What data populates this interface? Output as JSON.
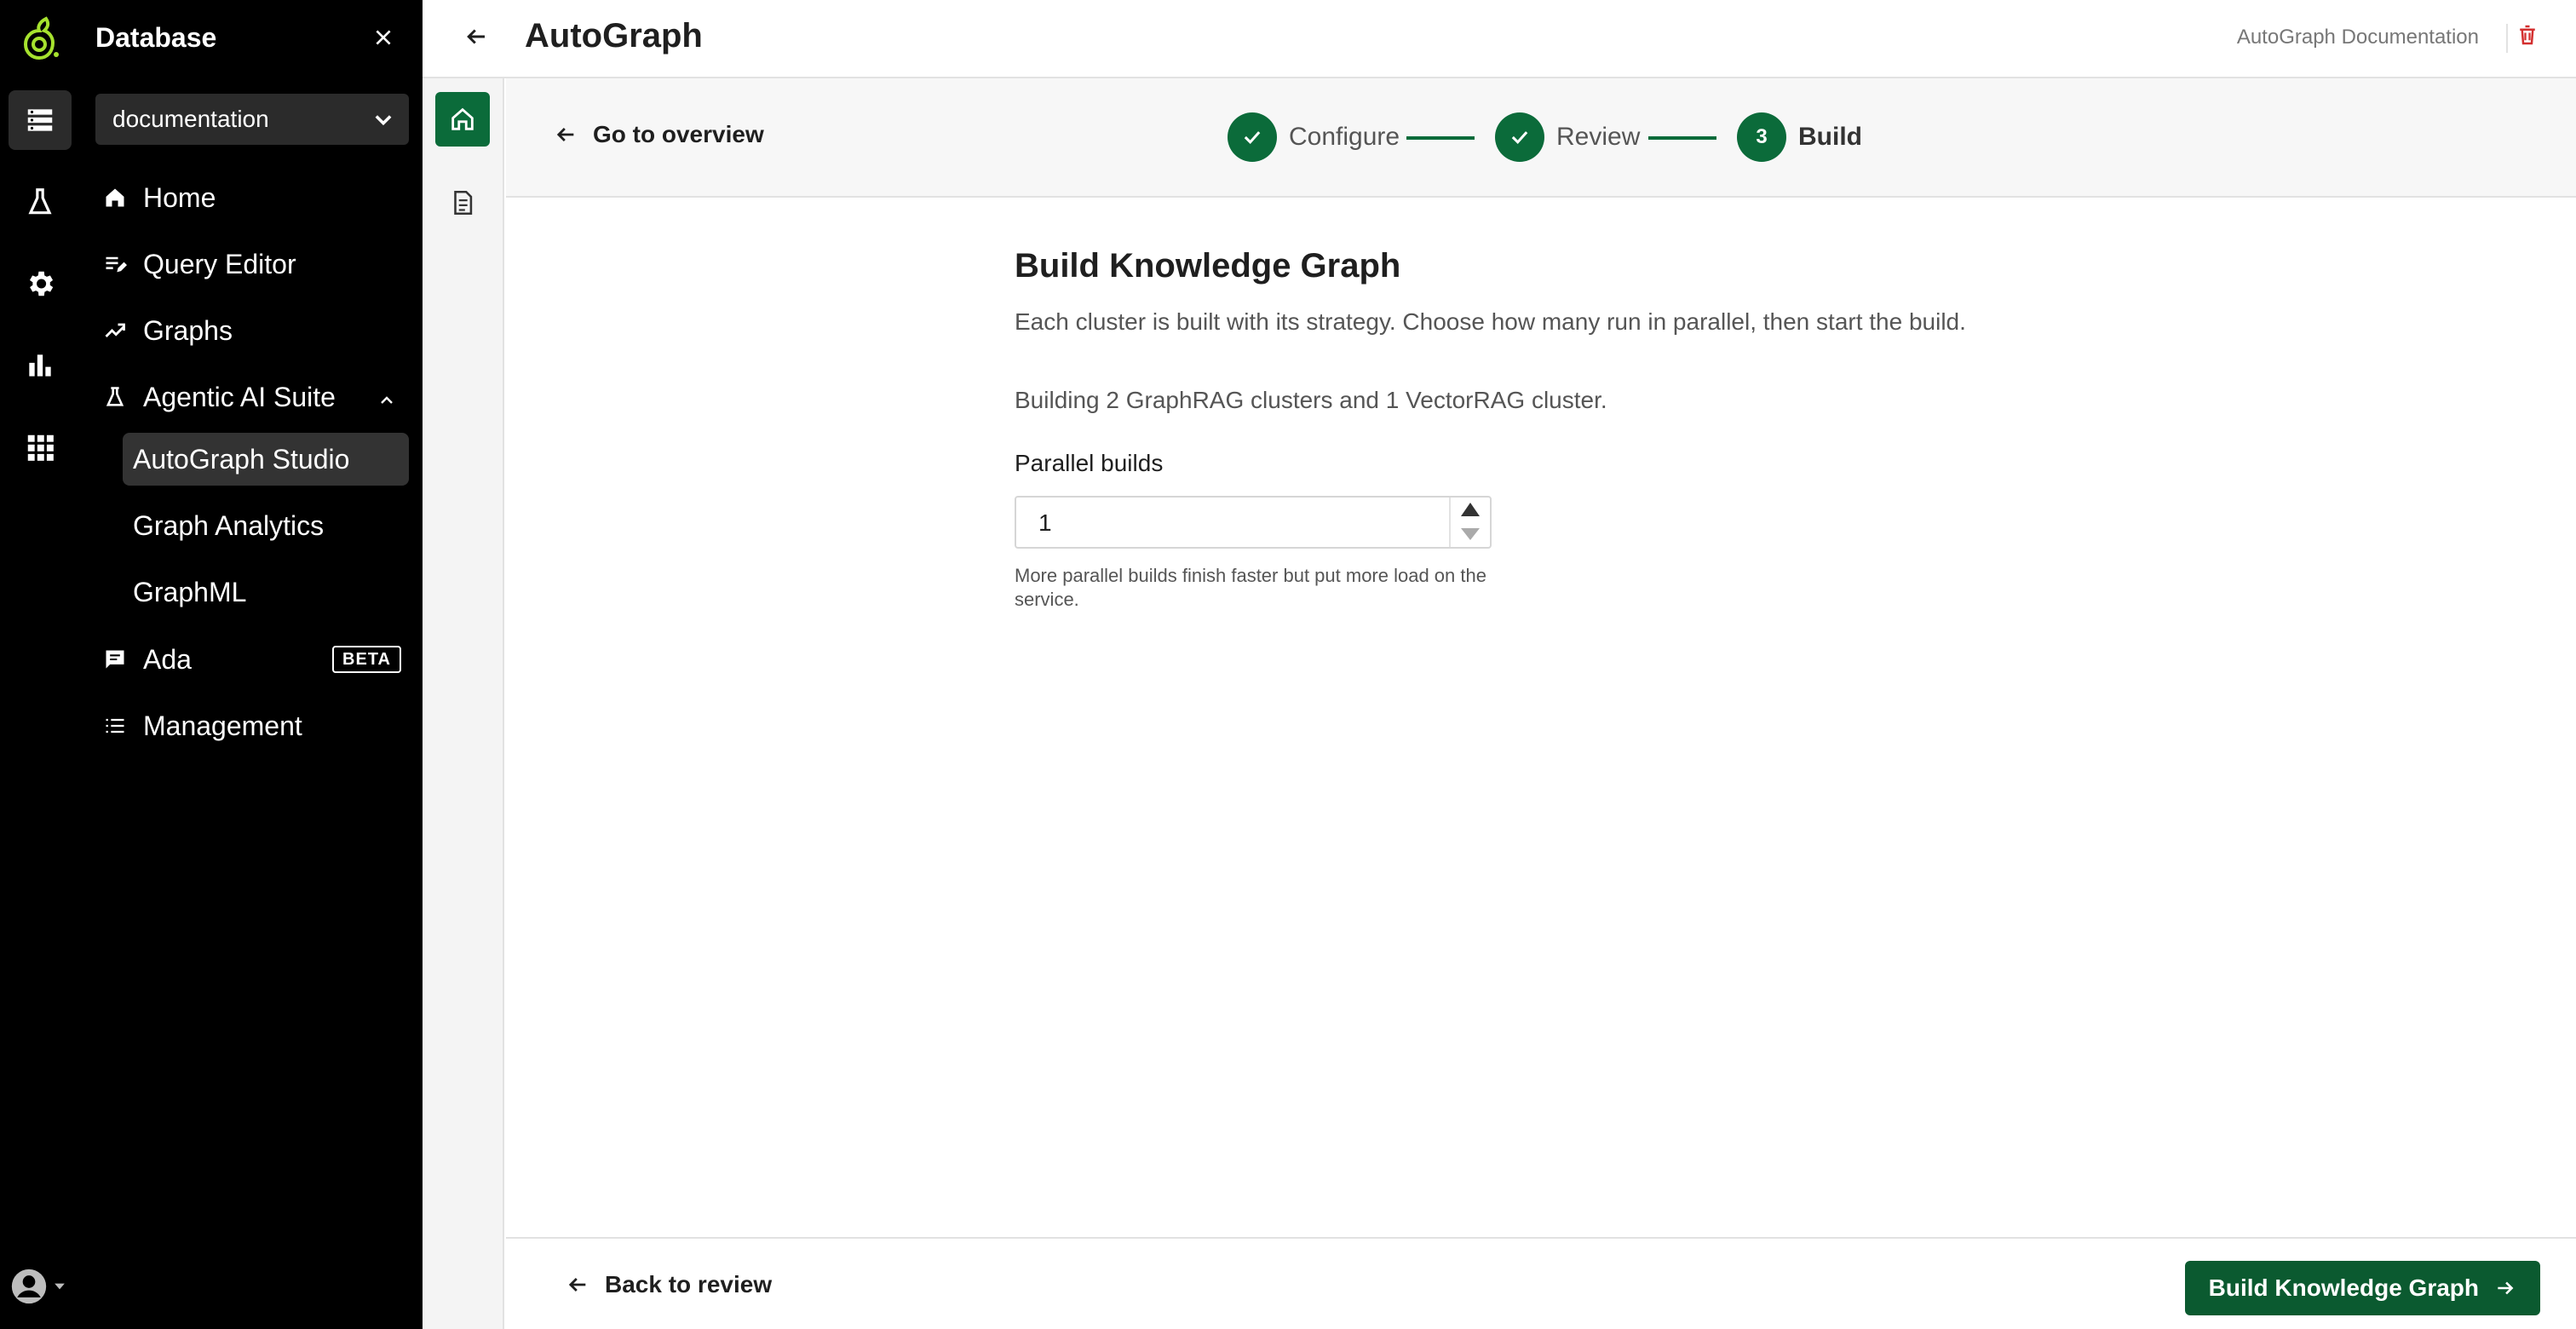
{
  "sidebar": {
    "title": "Database",
    "database_selector": {
      "value": "documentation"
    },
    "items": [
      {
        "label": "Home",
        "icon": "home-icon"
      },
      {
        "label": "Query Editor",
        "icon": "query-editor-icon"
      },
      {
        "label": "Graphs",
        "icon": "trending-icon"
      },
      {
        "label": "Agentic AI Suite",
        "icon": "flask-icon",
        "expanded": true
      },
      {
        "label": "Ada",
        "icon": "chat-icon",
        "badge": "BETA"
      },
      {
        "label": "Management",
        "icon": "list-icon"
      }
    ],
    "sub_items": [
      {
        "label": "AutoGraph Studio",
        "active": true
      },
      {
        "label": "Graph Analytics"
      },
      {
        "label": "GraphML"
      }
    ]
  },
  "header": {
    "title": "AutoGraph",
    "doc_link": "AutoGraph Documentation"
  },
  "stepper": {
    "go_overview": "Go to overview",
    "steps": [
      {
        "label": "Configure",
        "status": "complete"
      },
      {
        "label": "Review",
        "status": "complete"
      },
      {
        "number": "3",
        "label": "Build",
        "status": "current"
      }
    ]
  },
  "main": {
    "title": "Build Knowledge Graph",
    "subtitle": "Each cluster is built with its strategy. Choose how many run in parallel, then start the build.",
    "summary": "Building 2 GraphRAG clusters and 1 VectorRAG cluster.",
    "parallel_label": "Parallel builds",
    "parallel_value": "1",
    "helper_text": "More parallel builds finish faster but put more load on the service."
  },
  "footer": {
    "back_label": "Back to review",
    "primary_label": "Build Knowledge Graph"
  },
  "colors": {
    "accent": "#0b6b3a",
    "primary_button": "#0b5a30",
    "sidebar_bg": "#000000",
    "danger": "#d32f2f"
  }
}
